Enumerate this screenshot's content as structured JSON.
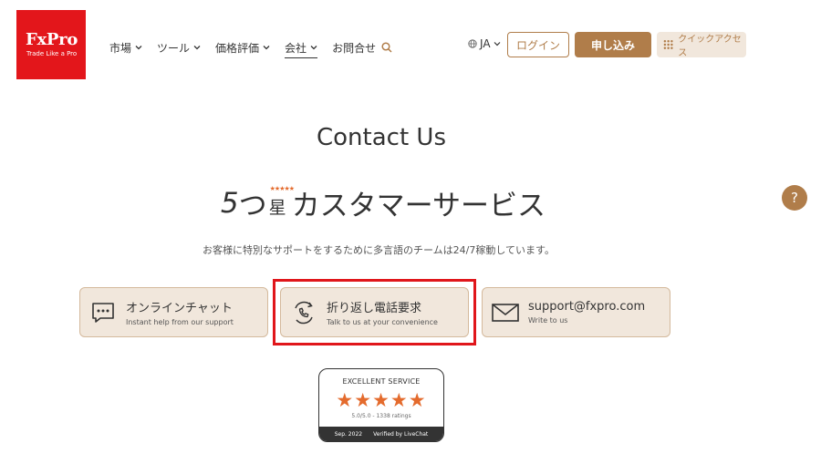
{
  "header": {
    "logo": {
      "name": "FxPro",
      "tagline": "Trade Like a Pro"
    },
    "nav": [
      {
        "label": "市場",
        "dropdown": true
      },
      {
        "label": "ツール",
        "dropdown": true
      },
      {
        "label": "価格評価",
        "dropdown": true
      },
      {
        "label": "会社",
        "dropdown": true,
        "active": true
      },
      {
        "label": "お問合せ",
        "dropdown": false
      }
    ],
    "search_icon": "search-icon",
    "language": "JA",
    "login_label": "ログイン",
    "signup_label": "申し込み",
    "quick_access_label": "クイックアクセス"
  },
  "main": {
    "title": "Contact Us",
    "headline_number": "5",
    "headline_tsu": "つ",
    "headline_star_kanji": "星",
    "headline_mini_stars": "★★★★★",
    "headline_rest": "カスタマーサービス",
    "subtitle": "お客様に特別なサポートをするために多言語のチームは24/7稼動しています。",
    "cards": [
      {
        "title": "オンラインチャット",
        "subtitle": "Instant help from our support",
        "icon": "chat-icon"
      },
      {
        "title": "折り返し電話要求",
        "subtitle": "Talk to us at your convenience",
        "icon": "phone-icon"
      },
      {
        "title": "support@fxpro.com",
        "subtitle": "Write to us",
        "icon": "mail-icon"
      }
    ],
    "badge": {
      "title": "EXCELLENT SERVICE",
      "stars": "★★★★★",
      "rating": "5.0/5.0 - 1338 ratings",
      "date": "Sep. 2022",
      "verified": "Verified by LiveChat"
    }
  },
  "help_button": "?",
  "colors": {
    "brand_red": "#e3161b",
    "accent": "#b07d4a",
    "card_bg": "#f1e7dc",
    "star": "#e46b2d"
  }
}
